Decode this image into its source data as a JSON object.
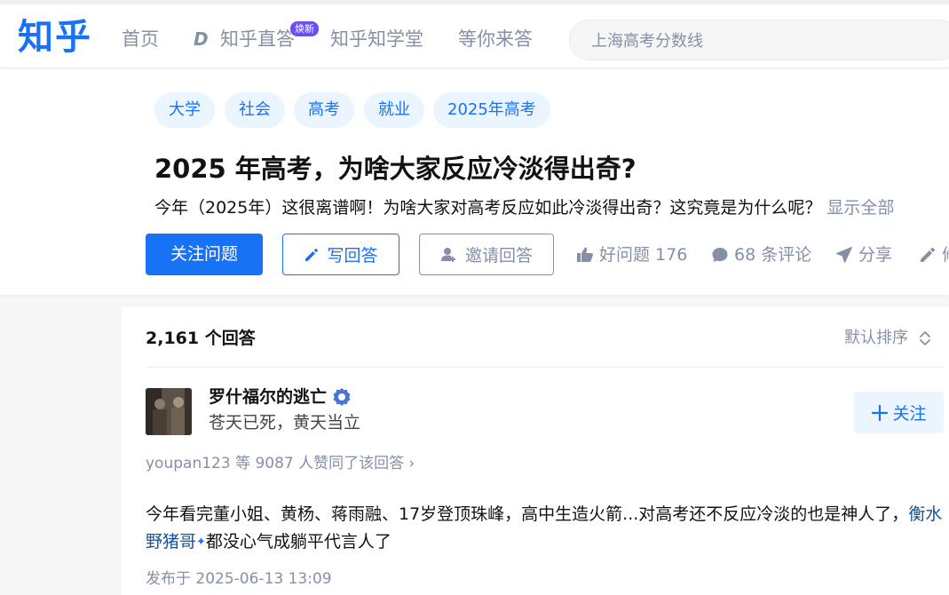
{
  "header": {
    "logo": "知乎",
    "nav": {
      "home": "首页",
      "zhida": "知乎直答",
      "zhida_badge": "焕新",
      "xuetang": "知乎知学堂",
      "wait": "等你来答"
    },
    "search": {
      "placeholder": "上海高考分数线"
    }
  },
  "question": {
    "tags": [
      "大学",
      "社会",
      "高考",
      "就业",
      "2025年高考"
    ],
    "title": "2025 年高考，为啥大家反应冷淡得出奇?",
    "description": "今年（2025年）这很离谱啊！为啥大家对高考反应如此冷淡得出奇？这究竟是为什么呢？",
    "show_all": "显示全部",
    "buttons": {
      "follow": "关注问题",
      "write": "写回答",
      "invite": "邀请回答"
    },
    "actions": {
      "good": "好问题 176",
      "comments": "68 条评论",
      "share": "分享",
      "edit": "修"
    }
  },
  "answers": {
    "count": "2,161 个回答",
    "sort": "默认排序",
    "items": [
      {
        "author": "罗什福尔的逃亡",
        "bio": "苍天已死，黄天当立",
        "follow": "关注",
        "voters": "youpan123 等 9087 人赞同了该回答 ›",
        "content_before": "今年看完董小姐、黄杨、蒋雨融、17岁登顶珠峰，高中生造火箭...对高考还不反应冷淡的也是神人了，",
        "content_link": "衡水野猪哥",
        "content_spark": "✦",
        "content_after": "都没心气成躺平代言人了",
        "published": "发布于 2025-06-13 13:09"
      }
    ]
  },
  "colors": {
    "brand": "#1772f6",
    "muted": "#8590a6",
    "tag_bg": "#ebf5ff",
    "badge": "#6b4ef6"
  }
}
